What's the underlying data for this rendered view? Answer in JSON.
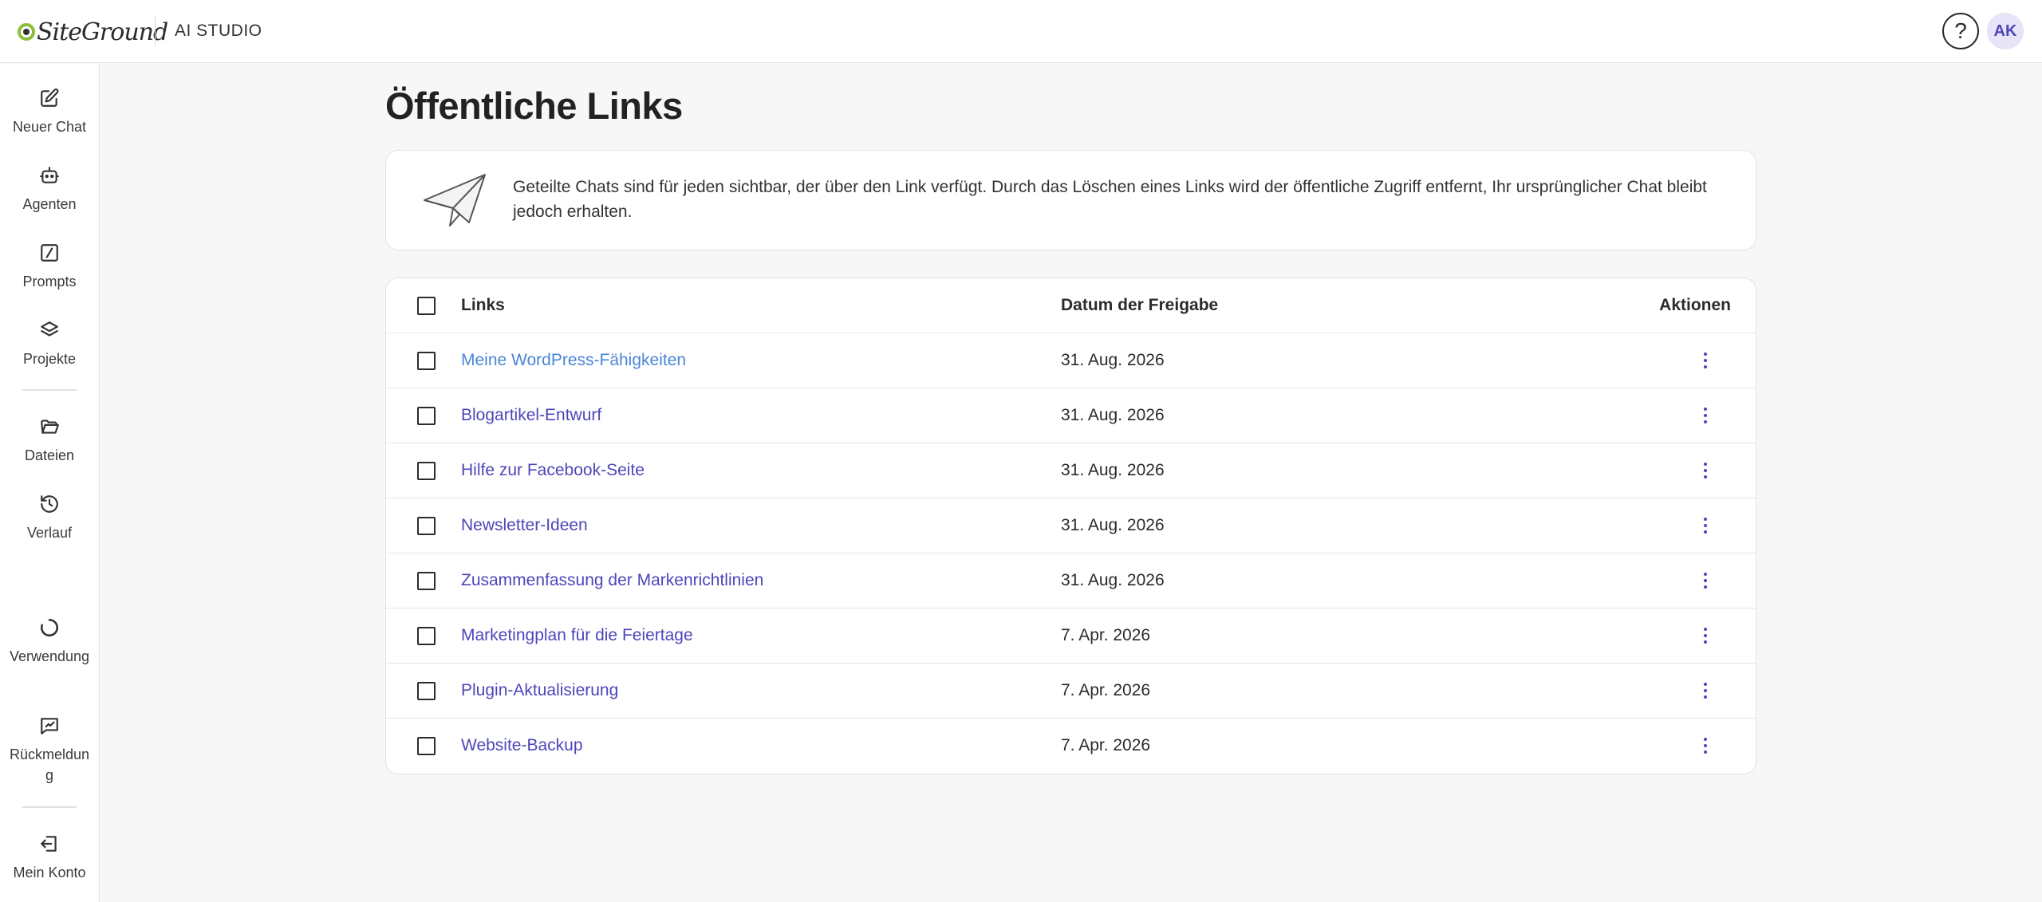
{
  "topbar": {
    "logo_text": "SiteGround",
    "app_title": "AI STUDIO",
    "help_icon": "question-mark-circle-icon",
    "avatar_initials": "AK"
  },
  "sidebar": {
    "items": [
      {
        "label": "Neuer Chat",
        "icon": "edit-square-icon"
      },
      {
        "label": "Agenten",
        "icon": "robot-icon"
      },
      {
        "label": "Prompts",
        "icon": "prompt-slash-icon"
      },
      {
        "label": "Projekte",
        "icon": "layers-icon"
      },
      {
        "label": "Dateien",
        "icon": "folder-open-icon"
      },
      {
        "label": "Verlauf",
        "icon": "history-icon"
      },
      {
        "label": "Verwendung",
        "icon": "usage-circle-icon"
      },
      {
        "label": "Rückmeldung",
        "icon": "feedback-icon"
      },
      {
        "label": "Mein Konto",
        "icon": "logout-icon"
      }
    ]
  },
  "page": {
    "title": "Öffentliche Links",
    "info_text": "Geteilte Chats sind für jeden sichtbar, der über den Link verfügt. Durch das Löschen eines Links wird der öffentliche Zugriff entfernt, Ihr ursprünglicher Chat bleibt jedoch erhalten."
  },
  "table": {
    "headers": {
      "links": "Links",
      "date": "Datum der Freigabe",
      "actions": "Aktionen"
    },
    "rows": [
      {
        "link": "Meine WordPress-Fähigkeiten",
        "date": "31. Aug. 2026"
      },
      {
        "link": "Blogartikel-Entwurf",
        "date": "31. Aug. 2026"
      },
      {
        "link": "Hilfe zur Facebook-Seite",
        "date": "31. Aug. 2026"
      },
      {
        "link": "Newsletter-Ideen",
        "date": "31. Aug. 2026"
      },
      {
        "link": "Zusammenfassung der Markenrichtlinien",
        "date": "31. Aug. 2026"
      },
      {
        "link": "Marketingplan für die Feiertage",
        "date": "7. Apr. 2026"
      },
      {
        "link": "Plugin-Aktualisierung",
        "date": "7. Apr. 2026"
      },
      {
        "link": "Website-Backup",
        "date": "7. Apr. 2026"
      }
    ]
  },
  "colors": {
    "accent": "#4e46b9",
    "link_hover": "#4a86d6",
    "logo_green": "#8bbd3a"
  }
}
